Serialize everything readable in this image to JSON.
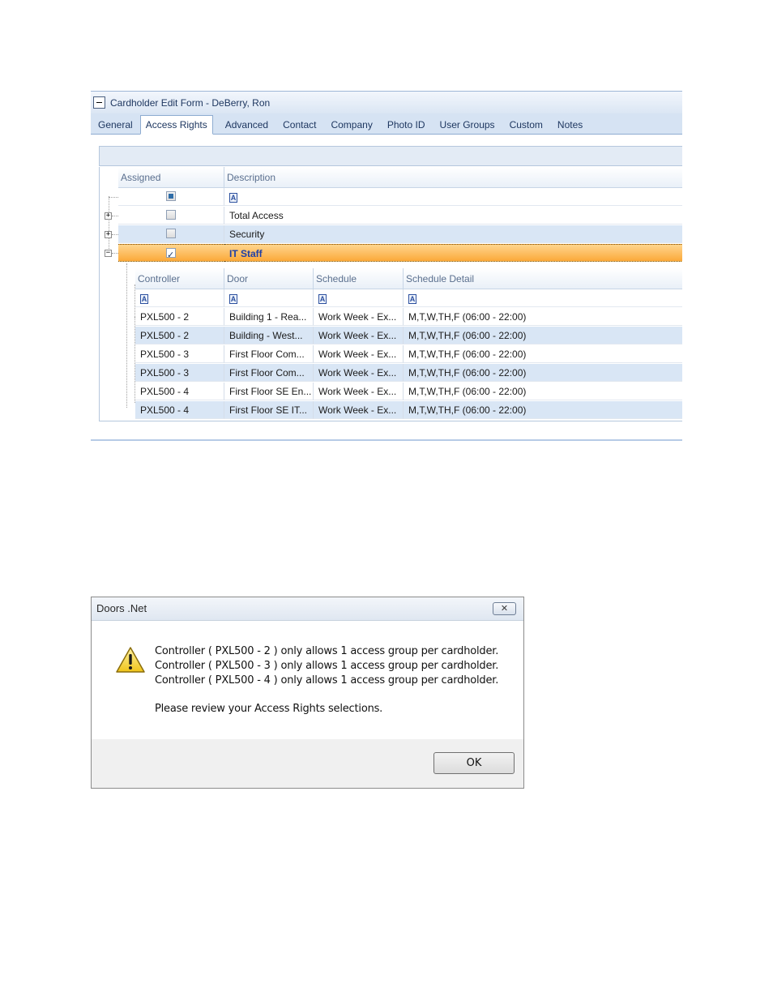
{
  "form": {
    "title": "Cardholder Edit Form - DeBerry, Ron",
    "tabs": [
      "General",
      "Access Rights",
      "Advanced",
      "Contact",
      "Company",
      "Photo ID",
      "User Groups",
      "Custom",
      "Notes"
    ],
    "active_tab": "Access Rights",
    "grid": {
      "columns": {
        "assigned": "Assigned",
        "description": "Description"
      },
      "rows": [
        {
          "description": "Total Access",
          "assigned": false
        },
        {
          "description": "Security",
          "assigned": false
        },
        {
          "description": "IT Staff",
          "assigned": true
        }
      ],
      "detail": {
        "columns": [
          "Controller",
          "Door",
          "Schedule",
          "Schedule Detail"
        ],
        "rows": [
          [
            "PXL500 - 2",
            "Building 1 - Rea...",
            "Work Week - Ex...",
            "M,T,W,TH,F (06:00 - 22:00)"
          ],
          [
            "PXL500 - 2",
            "Building - West...",
            "Work Week - Ex...",
            "M,T,W,TH,F (06:00 - 22:00)"
          ],
          [
            "PXL500 - 3",
            "First Floor Com...",
            "Work Week - Ex...",
            "M,T,W,TH,F (06:00 - 22:00)"
          ],
          [
            "PXL500 - 3",
            "First Floor Com...",
            "Work Week - Ex...",
            "M,T,W,TH,F (06:00 - 22:00)"
          ],
          [
            "PXL500 - 4",
            "First Floor SE En...",
            "Work Week - Ex...",
            "M,T,W,TH,F (06:00 - 22:00)"
          ],
          [
            "PXL500 - 4",
            "First Floor SE IT...",
            "Work Week - Ex...",
            "M,T,W,TH,F (06:00 - 22:00)"
          ]
        ]
      }
    },
    "filter_glyph": "A"
  },
  "dialog": {
    "title": "Doors .Net",
    "close_glyph": "✕",
    "icon": "warning-icon",
    "messages": [
      "Controller ( PXL500 - 2 ) only allows 1 access group per cardholder.",
      "Controller ( PXL500 - 3 ) only allows 1 access group per cardholder.",
      "Controller ( PXL500 - 4 ) only allows 1 access group per cardholder."
    ],
    "prompt": "Please review your Access Rights selections.",
    "ok_label": "OK"
  },
  "colors": {
    "selected_row": "#fba93a",
    "alt_row": "#d9e6f5",
    "accent": "#1f3fa6"
  }
}
